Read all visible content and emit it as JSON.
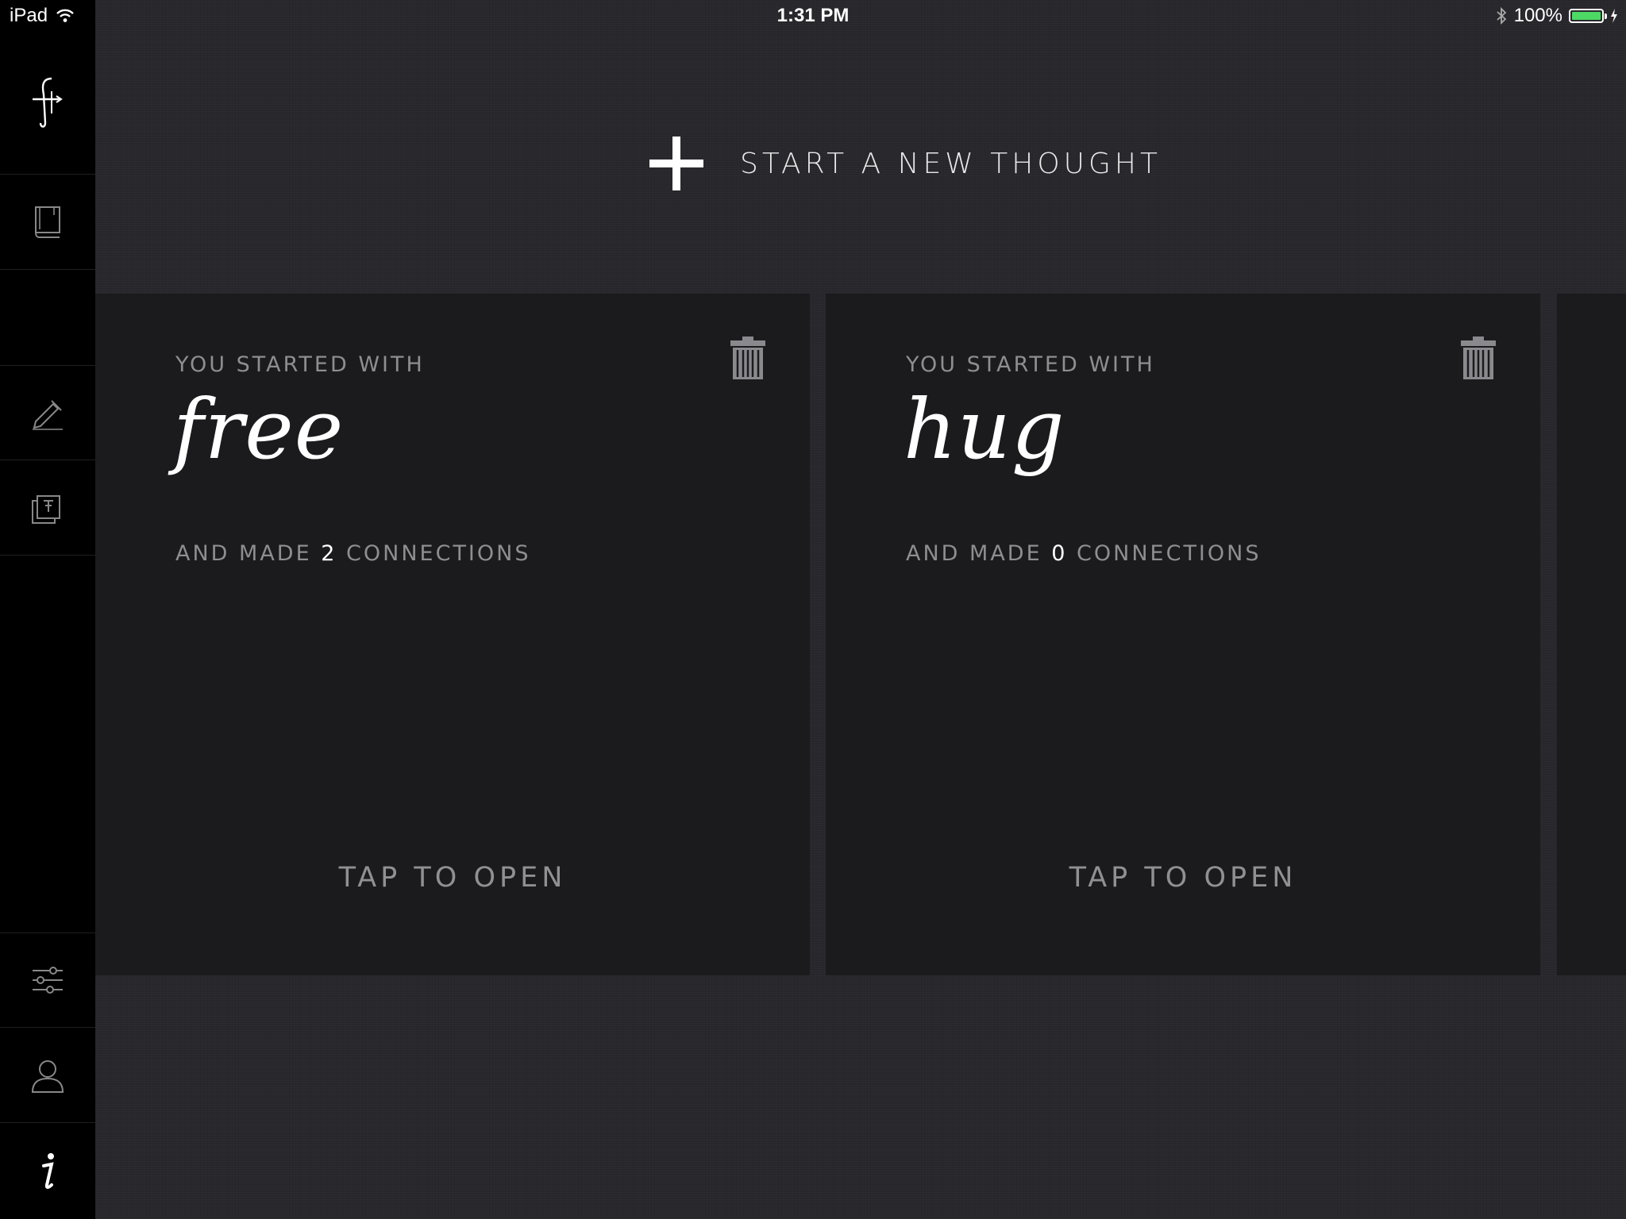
{
  "status_bar": {
    "device": "iPad",
    "time": "1:31 PM",
    "battery": "100%",
    "battery_level": 1.0
  },
  "sidebar": {
    "items": [
      {
        "name": "logo",
        "icon": "app-logo-icon"
      },
      {
        "name": "library",
        "icon": "book-icon"
      },
      {
        "name": "blank",
        "icon": ""
      },
      {
        "name": "write",
        "icon": "pen-icon"
      },
      {
        "name": "pinned",
        "icon": "pinned-cards-icon"
      },
      {
        "name": "settings",
        "icon": "sliders-icon"
      },
      {
        "name": "profile",
        "icon": "person-icon"
      },
      {
        "name": "info",
        "icon": "info-icon"
      }
    ]
  },
  "new_thought": {
    "label": "START A NEW THOUGHT",
    "icon": "plus-icon"
  },
  "cards": [
    {
      "eyebrow": "YOU STARTED WITH",
      "word": "free",
      "connections_prefix": "AND MADE",
      "connections_count": "2",
      "connections_suffix": "CONNECTIONS",
      "open_label": "TAP TO OPEN"
    },
    {
      "eyebrow": "YOU STARTED WITH",
      "word": "hug",
      "connections_prefix": "AND MADE",
      "connections_count": "0",
      "connections_suffix": "CONNECTIONS",
      "open_label": "TAP TO OPEN"
    }
  ],
  "colors": {
    "background": "#27272c",
    "sidebar": "#000000",
    "card": "#1b1b1d",
    "muted_text": "#8e8e92",
    "battery_green": "#4cd964"
  }
}
